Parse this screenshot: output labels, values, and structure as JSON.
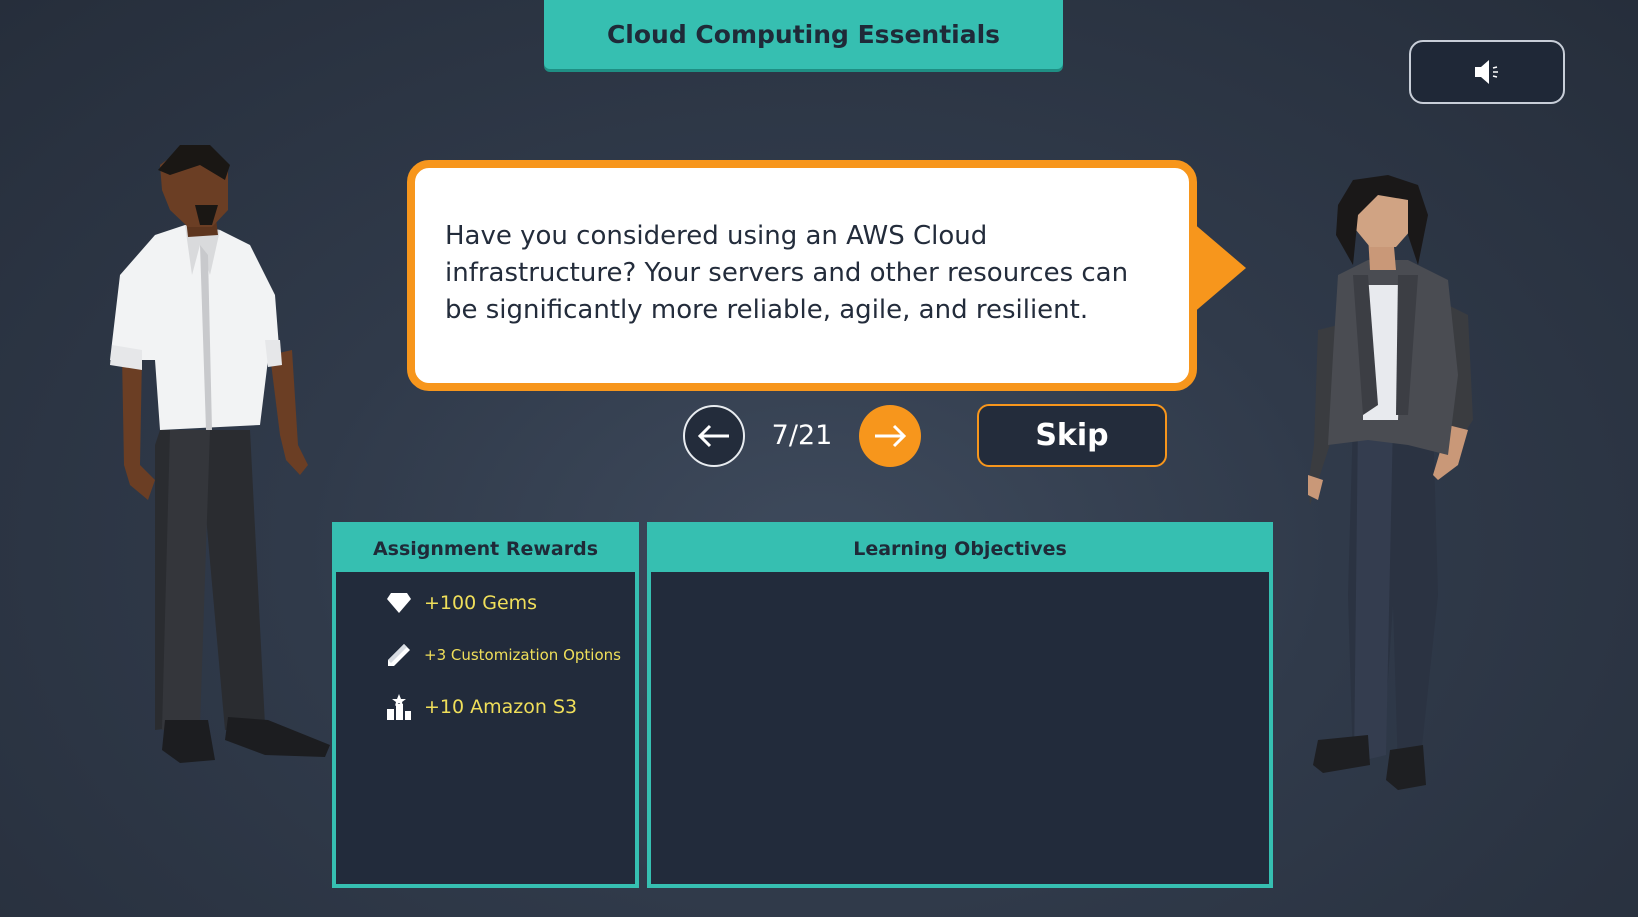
{
  "header": {
    "title": "Cloud Computing Essentials"
  },
  "sound_button": {
    "icon": "speaker-icon"
  },
  "dialog": {
    "text": "Have you considered using an AWS Cloud infrastructure? Your servers and other resources can be significantly more reliable, agile, and resilient."
  },
  "navigation": {
    "counter": "7/21",
    "skip_label": "Skip"
  },
  "rewards": {
    "title": "Assignment Rewards",
    "items": [
      {
        "icon": "gem-icon",
        "label": "+100 Gems"
      },
      {
        "icon": "pencil-icon",
        "label": "+3 Customization Options"
      },
      {
        "icon": "storage-icon",
        "label": "+10 Amazon S3"
      }
    ]
  },
  "objectives": {
    "title": "Learning Objectives"
  },
  "colors": {
    "accent_teal": "#36bfb1",
    "accent_orange": "#f7961c",
    "panel_bg": "#222b3b",
    "reward_text": "#f0df5a"
  }
}
